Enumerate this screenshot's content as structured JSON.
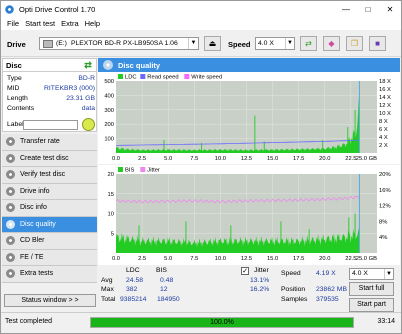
{
  "window": {
    "title": "Opti Drive Control 1.70",
    "minimize": "—",
    "maximize": "□",
    "close": "✕"
  },
  "menu": [
    "File",
    "Start test",
    "Extra",
    "Help"
  ],
  "toolbar": {
    "drive_label": "Drive",
    "drive_letter": "(E:)",
    "drive_name": "PLEXTOR BD-R  PX-LB950SA 1.06",
    "speed_label": "Speed",
    "speed_value": "4.0 X"
  },
  "disc": {
    "header": "Disc",
    "rows": [
      {
        "k": "Type",
        "v": "BD-R"
      },
      {
        "k": "MID",
        "v": "RITEKBR3 (000)"
      },
      {
        "k": "Length",
        "v": "23.31 GB"
      },
      {
        "k": "Contents",
        "v": "data"
      }
    ],
    "label_key": "Label"
  },
  "nav": [
    {
      "label": "Transfer rate",
      "active": false
    },
    {
      "label": "Create test disc",
      "active": false
    },
    {
      "label": "Verify test disc",
      "active": false
    },
    {
      "label": "Drive info",
      "active": false
    },
    {
      "label": "Disc info",
      "active": false
    },
    {
      "label": "Disc quality",
      "active": true
    },
    {
      "label": "CD Bler",
      "active": false
    },
    {
      "label": "FE / TE",
      "active": false
    },
    {
      "label": "Extra tests",
      "active": false
    }
  ],
  "status_window_btn": "Status window > >",
  "panel_title": "Disc quality",
  "chart_data": [
    {
      "type": "area",
      "legend": [
        "LDC",
        "Read speed",
        "Write speed"
      ],
      "colors": {
        "LDC": "#22cc22",
        "Read speed": "#6a6aff",
        "Write speed": "#ff66ff",
        "bg": "#c8d0c8"
      },
      "x_ticks": [
        "0.0",
        "2.5",
        "5.0",
        "7.5",
        "10.0",
        "12.5",
        "15.0",
        "17.5",
        "20.0",
        "22.5",
        "25.0 GB"
      ],
      "y_left_ticks": [
        "500",
        "400",
        "300",
        "200",
        "100"
      ],
      "y_right_ticks": [
        "18 X",
        "16 X",
        "14 X",
        "12 X",
        "10 X",
        "8 X",
        "6 X",
        "4 X",
        "2 X"
      ],
      "xlim": [
        0,
        25
      ],
      "ylim": [
        0,
        500
      ],
      "ldc_profile": [
        [
          0,
          35
        ],
        [
          1,
          25
        ],
        [
          2.5,
          20
        ],
        [
          5,
          22
        ],
        [
          7.5,
          20
        ],
        [
          10,
          22
        ],
        [
          12.5,
          20
        ],
        [
          15,
          22
        ],
        [
          17.5,
          25
        ],
        [
          20,
          30
        ],
        [
          21,
          40
        ],
        [
          22,
          60
        ],
        [
          22.5,
          100
        ],
        [
          23,
          150
        ],
        [
          23.3,
          320
        ]
      ],
      "ldc_spikes": [
        [
          4.6,
          90
        ],
        [
          8.2,
          70
        ],
        [
          13.3,
          260
        ],
        [
          14.2,
          80
        ],
        [
          19.8,
          90
        ],
        [
          22.2,
          180
        ],
        [
          22.9,
          300
        ]
      ],
      "read_speed": [
        [
          0,
          1.9
        ],
        [
          5,
          2.1
        ],
        [
          10,
          2.3
        ],
        [
          15,
          2.6
        ],
        [
          20,
          2.9
        ],
        [
          23.3,
          3.2
        ]
      ]
    },
    {
      "type": "area",
      "legend": [
        "BIS",
        "Jitter"
      ],
      "colors": {
        "BIS": "#22cc22",
        "Jitter": "#ee88ee",
        "bg": "#c8d0c8"
      },
      "x_ticks": [
        "0.0",
        "2.5",
        "5.0",
        "7.5",
        "10.0",
        "12.5",
        "15.0",
        "17.5",
        "20.0",
        "22.5",
        "25.0 GB"
      ],
      "y_left_ticks": [
        "20",
        "15",
        "10",
        "5"
      ],
      "y_right_ticks": [
        "20%",
        "16%",
        "12%",
        "8%",
        "4%"
      ],
      "xlim": [
        0,
        25
      ],
      "ylim": [
        0,
        20
      ],
      "bis_profile": [
        [
          0,
          4
        ],
        [
          2.5,
          3
        ],
        [
          5,
          3
        ],
        [
          7.5,
          2.5
        ],
        [
          10,
          3
        ],
        [
          12.5,
          3
        ],
        [
          15,
          3
        ],
        [
          17.5,
          3
        ],
        [
          20,
          3.5
        ],
        [
          22,
          4
        ],
        [
          23.3,
          5
        ]
      ],
      "bis_spikes": [
        [
          2.2,
          7
        ],
        [
          6.7,
          8
        ],
        [
          11,
          7
        ],
        [
          15.8,
          8
        ],
        [
          18.5,
          6
        ],
        [
          22.3,
          9
        ],
        [
          22.9,
          10
        ]
      ],
      "jitter": [
        [
          0,
          13.2
        ],
        [
          2.5,
          13.0
        ],
        [
          5,
          13.1
        ],
        [
          7.5,
          13.2
        ],
        [
          10,
          13.0
        ],
        [
          12.5,
          13.2
        ],
        [
          15,
          13.3
        ],
        [
          17.5,
          13.4
        ],
        [
          20,
          13.6
        ],
        [
          22,
          13.8
        ],
        [
          23.3,
          14.2
        ]
      ]
    }
  ],
  "stats": {
    "col_ldc": "LDC",
    "col_bis": "BIS",
    "rows": [
      {
        "k": "Avg",
        "ldc": "24.58",
        "bis": "0.48",
        "jit": "13.1%"
      },
      {
        "k": "Max",
        "ldc": "382",
        "bis": "12",
        "jit": "16.2%"
      },
      {
        "k": "Total",
        "ldc": "9385214",
        "bis": "184950",
        "jit": ""
      }
    ],
    "jitter_label": "Jitter",
    "jitter_checked": "✓",
    "speed_label": "Speed",
    "speed_value": "4.19 X",
    "position_label": "Position",
    "position_value": "23862 MB",
    "samples_label": "Samples",
    "samples_value": "379535",
    "speed_select": "4.0 X",
    "start_full": "Start full",
    "start_part": "Start part"
  },
  "statusbar": {
    "text": "Test completed",
    "progress": 100,
    "progress_text": "100.0%",
    "time": "33:14"
  }
}
